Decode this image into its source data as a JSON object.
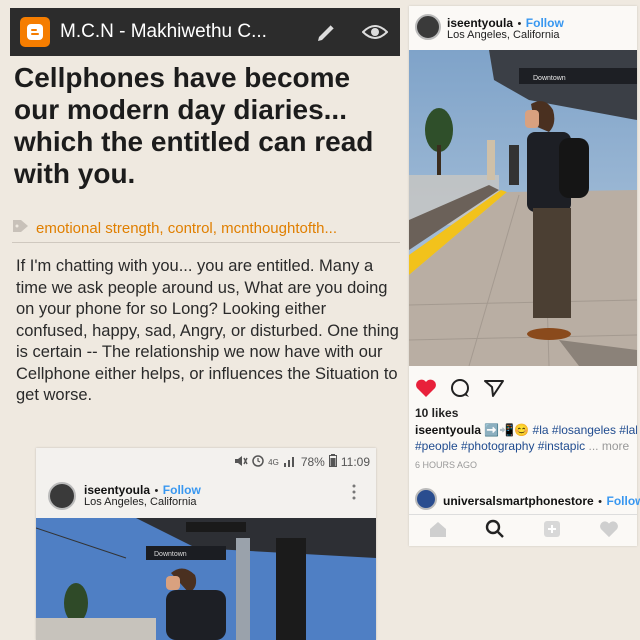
{
  "blog": {
    "app_title": "M.C.N - Makhiwethu C...",
    "icons": {
      "logo": "blogger-logo-icon",
      "edit": "pencil-icon",
      "view": "eye-icon"
    }
  },
  "post": {
    "title": "Cellphones have become our modern day diaries... which the entitled can read with you.",
    "labels": "emotional strength, control, mcnthoughtofth...",
    "body": "If I'm chatting with you... you are entitled. Many a time we ask people around us, What are you doing on your phone for so Long? Looking either confused, happy, sad, Angry, or disturbed. One thing is certain -- The relationship we now have with our Cellphone either helps, or influences the Situation to get worse."
  },
  "instagram": {
    "username": "iseentyoula",
    "follow": "Follow",
    "separator": "•",
    "location": "Los Angeles, California",
    "likes": "10 likes",
    "caption_user": "iseentyoula",
    "caption_emoji": "➡️📲😊",
    "caption_line1_tags": "#la #losangeles #lalife",
    "caption_line2_tags": "#people #photography #instapic",
    "more": "... more",
    "time": "6 HOURS AGO",
    "next_user": "universalsmartphonestore",
    "next_follow": "Follow",
    "colors": {
      "heart": "#e8203a",
      "link": "#3897f0"
    },
    "platform_sign": "Downtown"
  },
  "phone": {
    "status": {
      "battery": "78%",
      "time": "11:09",
      "network": "4G"
    },
    "username": "iseentyoula",
    "follow": "Follow",
    "location": "Los Angeles, California",
    "platform_sign": "Downtown"
  }
}
